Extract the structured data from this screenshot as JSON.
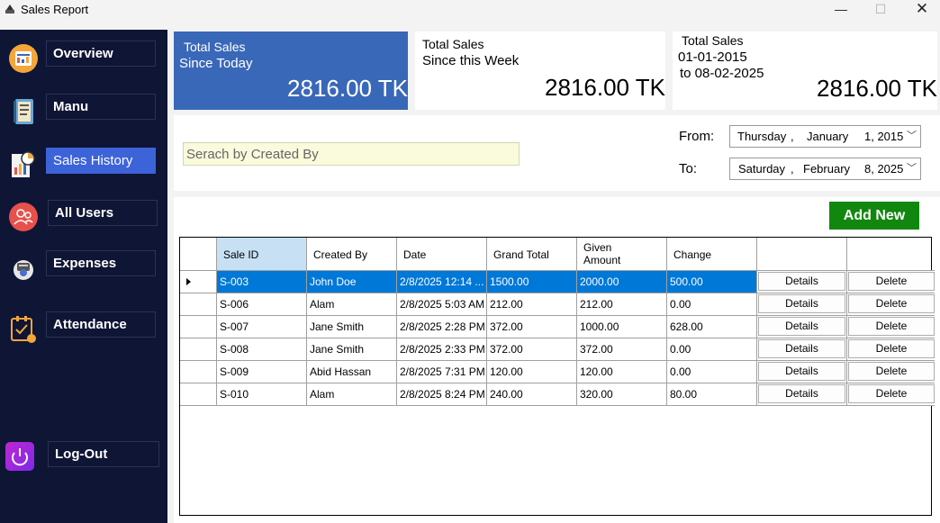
{
  "window": {
    "title": "Sales Report",
    "min_glyph": "—",
    "max_glyph": "☐",
    "close_glyph": "✕"
  },
  "sidebar": {
    "items": [
      {
        "label": "Overview",
        "icon": "overview-icon"
      },
      {
        "label": "Manu",
        "icon": "menu-book-icon"
      },
      {
        "label": "Sales History",
        "icon": "sales-history-icon"
      },
      {
        "label": "All Users",
        "icon": "users-icon"
      },
      {
        "label": "Expenses",
        "icon": "expenses-icon"
      },
      {
        "label": "Attendance",
        "icon": "attendance-icon"
      }
    ],
    "logout": {
      "label": "Log-Out",
      "icon": "power-icon"
    },
    "active_item": "Sales History"
  },
  "cards": [
    {
      "line1": "Total Sales",
      "line2": "Since Today",
      "value": "2816.00 TK"
    },
    {
      "line1": "Total Sales",
      "line2": "Since this Week",
      "value": "2816.00 TK"
    },
    {
      "line1": "Total Sales",
      "line2": "01-01-2015",
      "line3": "to  08-02-2025",
      "value": "2816.00 TK"
    }
  ],
  "filter": {
    "search_placeholder": "Serach by Created By",
    "from_label": "From:",
    "to_label": "To:",
    "from_date": {
      "weekday": "Thursday",
      "sep": ",",
      "month": "January",
      "day_year": "1, 2015"
    },
    "to_date": {
      "weekday": "Saturday",
      "sep": ",",
      "month": "February",
      "day_year": "8, 2025"
    }
  },
  "add_new_label": "Add New",
  "table": {
    "headers": [
      "Sale ID",
      "Created By",
      "Date",
      "Grand Total",
      "Given\nAmount",
      "Change",
      "",
      ""
    ],
    "rows": [
      {
        "id": "S-003",
        "by": "John Doe",
        "date": "2/8/2025 12:14 ...",
        "total": "1500.00",
        "given": "2000.00",
        "change": "500.00",
        "details": "Details",
        "delete": "Delete"
      },
      {
        "id": "S-006",
        "by": "Alam",
        "date": "2/8/2025 5:03 AM",
        "total": "212.00",
        "given": "212.00",
        "change": "0.00",
        "details": "Details",
        "delete": "Delete"
      },
      {
        "id": "S-007",
        "by": "Jane Smith",
        "date": "2/8/2025 2:28 PM",
        "total": "372.00",
        "given": "1000.00",
        "change": "628.00",
        "details": "Details",
        "delete": "Delete"
      },
      {
        "id": "S-008",
        "by": "Jane Smith",
        "date": "2/8/2025 2:33 PM",
        "total": "372.00",
        "given": "372.00",
        "change": "0.00",
        "details": "Details",
        "delete": "Delete"
      },
      {
        "id": "S-009",
        "by": "Abid Hassan",
        "date": "2/8/2025 7:31 PM",
        "total": "120.00",
        "given": "120.00",
        "change": "0.00",
        "details": "Details",
        "delete": "Delete"
      },
      {
        "id": "S-010",
        "by": "Alam",
        "date": "2/8/2025 8:24 PM",
        "total": "240.00",
        "given": "320.00",
        "change": "80.00",
        "details": "Details",
        "delete": "Delete"
      }
    ],
    "selected_row": 0
  },
  "colors": {
    "sidebar_bg": "#0f1535",
    "active_nav": "#3d63d9",
    "card_today_bg": "#3a68b8",
    "add_button": "#12870f",
    "selection": "#0078d7",
    "header_selected": "#c7e0f4"
  }
}
